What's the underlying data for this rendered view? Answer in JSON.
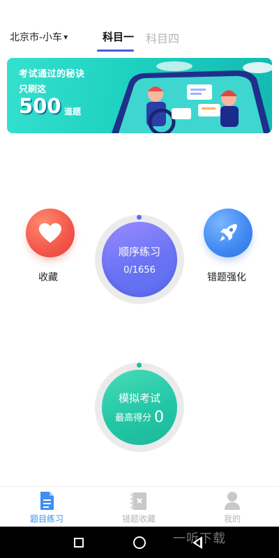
{
  "header": {
    "city": "北京市-小车",
    "tabs": [
      {
        "label": "科目一",
        "active": true
      },
      {
        "label": "科目四",
        "active": false
      }
    ]
  },
  "banner": {
    "line1": "考试通过的秘诀",
    "line2": "只刷这",
    "number": "500",
    "unit": "道题"
  },
  "actions": {
    "favorite": {
      "label": "收藏",
      "icon": "heart-icon",
      "color": "#f2564a"
    },
    "wrong_review": {
      "label": "错题强化",
      "icon": "rocket-icon",
      "color": "#3f87f2"
    }
  },
  "sequential_practice": {
    "title": "顺序练习",
    "progress_text": "0/1656",
    "color": "#6a73f4"
  },
  "mock_exam": {
    "title": "模拟考试",
    "score_label": "最高得分",
    "score_value": "0",
    "color": "#23c7a6"
  },
  "tabbar": {
    "items": [
      {
        "label": "题目练习",
        "icon": "document-icon",
        "active": true
      },
      {
        "label": "错题收藏",
        "icon": "folder-x-icon",
        "active": false
      },
      {
        "label": "我的",
        "icon": "user-icon",
        "active": false
      }
    ]
  },
  "system_nav": {
    "recent": "recent-apps-icon",
    "home": "home-icon",
    "back": "back-icon"
  },
  "watermark": "一听下载"
}
